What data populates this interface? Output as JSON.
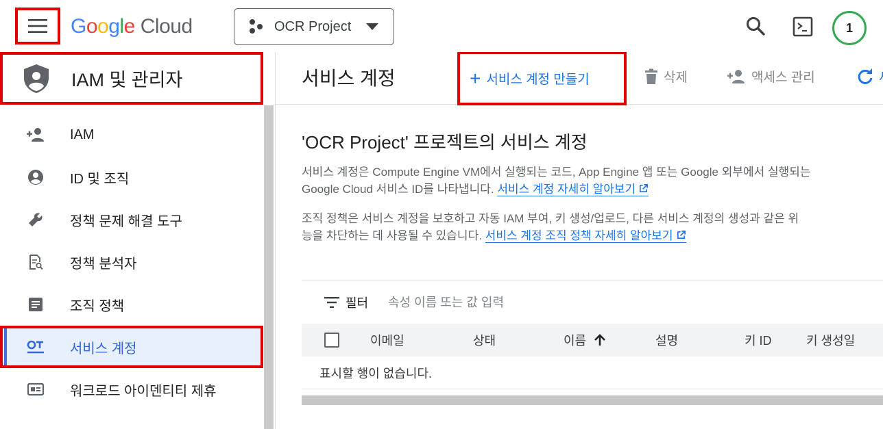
{
  "topbar": {
    "logo_google_letters": [
      "G",
      "o",
      "o",
      "g",
      "l",
      "e"
    ],
    "logo_cloud": "Cloud",
    "project_name": "OCR Project",
    "badge_count": "1"
  },
  "sidebar": {
    "section_title": "IAM 및 관리자",
    "items": [
      {
        "label": "IAM",
        "icon": "person-add-icon"
      },
      {
        "label": "ID 및 조직",
        "icon": "account-circle-icon"
      },
      {
        "label": "정책 문제 해결 도구",
        "icon": "wrench-icon"
      },
      {
        "label": "정책 분석자",
        "icon": "document-search-icon"
      },
      {
        "label": "조직 정책",
        "icon": "article-icon"
      },
      {
        "label": "서비스 계정",
        "icon": "service-account-icon",
        "active": true
      },
      {
        "label": "워크로드 아이덴티티 제휴",
        "icon": "id-card-icon"
      }
    ]
  },
  "toolbar": {
    "page_title": "서비스 계정",
    "create_label": "서비스 계정 만들기",
    "delete_label": "삭제",
    "access_label": "액세스 관리",
    "refresh_label": "새"
  },
  "content": {
    "heading": "'OCR Project' 프로젝트의 서비스 계정",
    "desc1_line1": "서비스 계정은 Compute Engine VM에서 실행되는 코드, App Engine 앱 또는 Google 외부에서 실행되는",
    "desc1_line2": "Google Cloud 서비스 ID를 나타냅니다. ",
    "desc1_link": "서비스 계정 자세히 알아보기",
    "desc2_line1": "조직 정책은 서비스 계정을 보호하고 자동 IAM 부여, 키 생성/업로드, 다른 서비스 계정의 생성과 같은 위",
    "desc2_line2": "능을 차단하는 데 사용될 수 있습니다. ",
    "desc2_link": "서비스 계정 조직 정책 자세히 알아보기"
  },
  "table": {
    "filter_label": "필터",
    "filter_placeholder": "속성 이름 또는 값 입력",
    "columns": {
      "email": "이메일",
      "status": "상태",
      "name": "이름",
      "description": "설명",
      "key_id": "키 ID",
      "key_created": "키 생성일"
    },
    "sort_column": "name",
    "sort_direction": "ascending",
    "empty_text": "표시할 행이 없습니다."
  },
  "colors": {
    "highlight_border": "#e00000",
    "link_blue": "#1a73e8",
    "active_bg": "#e8f0fe",
    "badge_green": "#34a853"
  }
}
